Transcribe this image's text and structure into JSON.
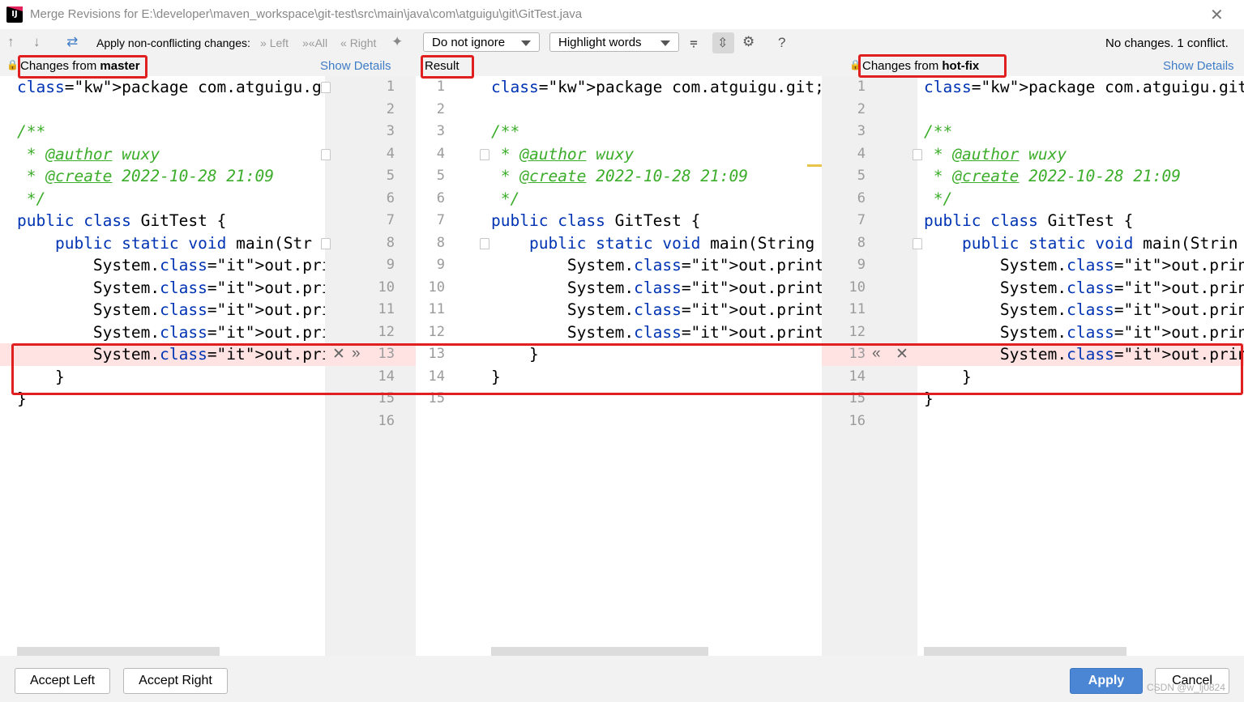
{
  "window": {
    "title": "Merge Revisions for E:\\developer\\maven_workspace\\git-test\\src\\main\\java\\com\\atguigu\\git\\GitTest.java",
    "app_icon": "intellij-icon",
    "close_icon": "close-icon"
  },
  "toolbar": {
    "apply_label": "Apply non-conflicting changes:",
    "left_label": "Left",
    "all_label": "All",
    "right_label": "Right",
    "ignore_dropdown": "Do not ignore",
    "highlight_dropdown": "Highlight words",
    "help": "?",
    "status": "No changes. 1 conflict."
  },
  "left_panel": {
    "header_prefix": "Changes from ",
    "header_branch": "master",
    "show_details": "Show Details",
    "lines": [
      "package com.atguigu.git;",
      "",
      "/**",
      " * @author wuxy",
      " * @create 2022-10-28 21:09",
      " */",
      "public class GitTest {",
      "    public static void main(Str",
      "        System.out.println(\"hel",
      "        System.out.println(\"hel",
      "        System.out.println(\"hel",
      "        System.out.println(\"hel",
      "        System.out.println(\"mas",
      "    }",
      "}",
      ""
    ],
    "line_numbers": [
      "1",
      "2",
      "3",
      "4",
      "5",
      "6",
      "7",
      "8",
      "9",
      "10",
      "11",
      "12",
      "13",
      "14",
      "15",
      "16"
    ]
  },
  "result_panel": {
    "header": "Result",
    "lines": [
      "package com.atguigu.git;",
      "",
      "/**",
      " * @author wuxy",
      " * @create 2022-10-28 21:09",
      " */",
      "public class GitTest {",
      "    public static void main(String",
      "        System.out.println(\"hello",
      "        System.out.println(\"hello",
      "        System.out.println(\"hello",
      "        System.out.println(\"hello",
      "    }",
      "}",
      ""
    ],
    "line_numbers": [
      "1",
      "2",
      "3",
      "4",
      "5",
      "6",
      "7",
      "8",
      "9",
      "10",
      "11",
      "12",
      "13",
      "14",
      "15"
    ]
  },
  "right_panel": {
    "header_prefix": "Changes from ",
    "header_branch": "hot-fix",
    "show_details": "Show Details",
    "lines": [
      "package com.atguigu.git;",
      "",
      "/**",
      " * @author wuxy",
      " * @create 2022-10-28 21:09",
      " */",
      "public class GitTest {",
      "    public static void main(Strin",
      "        System.out.println(\"hello",
      "        System.out.println(\"hello",
      "        System.out.println(\"hello",
      "        System.out.println(\"hello",
      "        System.out.println(\"hot-f",
      "    }",
      "}",
      ""
    ],
    "line_numbers": [
      "1",
      "2",
      "3",
      "4",
      "5",
      "6",
      "7",
      "8",
      "9",
      "10",
      "11",
      "12",
      "13",
      "14",
      "15",
      "16"
    ]
  },
  "buttons": {
    "accept_left": "Accept Left",
    "accept_right": "Accept Right",
    "apply": "Apply",
    "cancel": "Cancel"
  },
  "watermark": "CSDN @w_lj0824",
  "colors": {
    "keyword": "#0033b3",
    "comment": "#3cad2a",
    "static_field": "#871094",
    "conflict": "#ffe3e3",
    "annotation_box": "#e02020",
    "link": "#3f7cc6"
  }
}
